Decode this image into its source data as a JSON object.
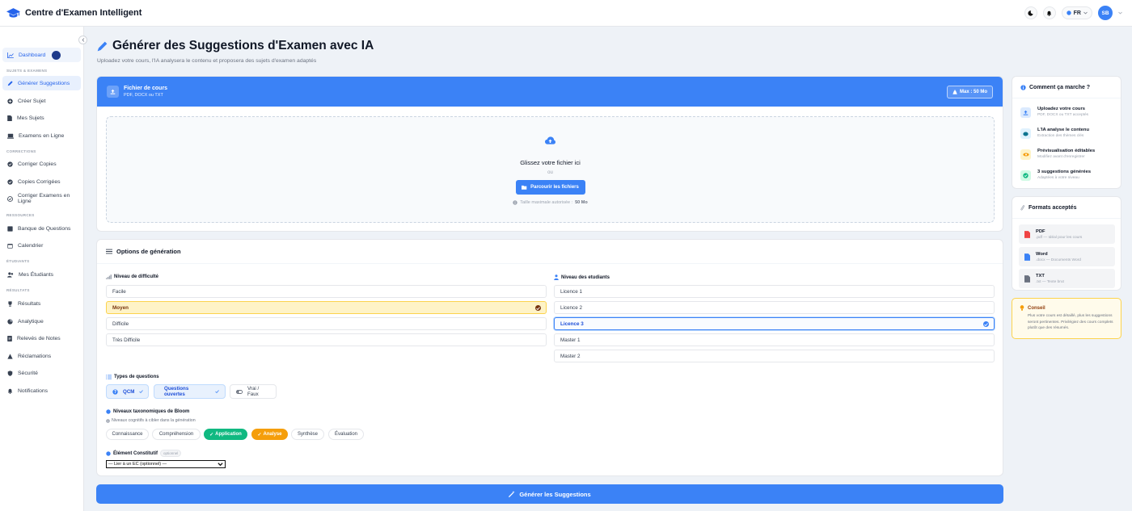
{
  "app": {
    "title": "Centre d'Examen Intelligent"
  },
  "topbar": {
    "lang": "FR",
    "user_initials": "SB"
  },
  "sidebar": {
    "dashboard": "Dashboard",
    "sections": {
      "sujets": "SUJETS & EXAMENS",
      "corrections": "CORRECTIONS",
      "ressources": "RESSOURCES",
      "etudiants": "ÉTUDIANTS",
      "resultats": "RÉSULTATS"
    },
    "items": [
      {
        "label": "Générer Suggestions"
      },
      {
        "label": "Créer Sujet"
      },
      {
        "label": "Mes Sujets"
      },
      {
        "label": "Examens en Ligne"
      },
      {
        "label": "Corriger Copies"
      },
      {
        "label": "Copies Corrigées"
      },
      {
        "label": "Corriger Examens en Ligne"
      },
      {
        "label": "Banque de Questions"
      },
      {
        "label": "Calendrier"
      },
      {
        "label": "Mes Étudiants"
      },
      {
        "label": "Résultats"
      },
      {
        "label": "Analytique"
      },
      {
        "label": "Relevés de Notes"
      },
      {
        "label": "Réclamations"
      },
      {
        "label": "Sécurité"
      },
      {
        "label": "Notifications"
      }
    ]
  },
  "page": {
    "title": "Générer des Suggestions d'Examen avec IA",
    "subtitle": "Uploadez votre cours, l'IA analysera le contenu et proposera des sujets d'examen adaptés"
  },
  "upload": {
    "title": "Fichier de cours",
    "subtitle": "PDF, DOCX ou TXT",
    "max_badge": "Max : 50 Mo",
    "drop_title": "Glissez votre fichier ici",
    "or": "ou",
    "browse": "Parcourir les fichiers",
    "size_note": "Taille maximale autorisée :",
    "size_value": "50 Mo"
  },
  "options": {
    "title": "Options de génération",
    "difficulty_label": "Niveau de difficulté",
    "difficulty": [
      "Facile",
      "Moyen",
      "Difficile",
      "Très Difficile"
    ],
    "students_label": "Niveau des etudiants",
    "students": [
      "Licence 1",
      "Licence 2",
      "Licence 3",
      "Master 1",
      "Master 2"
    ],
    "types_label": "Types de questions",
    "types": [
      "QCM",
      "Questions ouvertes",
      "Vrai / Faux"
    ],
    "bloom_label": "Niveaux taxonomiques de Bloom",
    "bloom_sub": "Niveaux cognitifs à cibler dans la génération",
    "bloom": [
      "Connaissance",
      "Compréhension",
      "Application",
      "Analyse",
      "Synthèse",
      "Évaluation"
    ],
    "ec_label": "Élément Constitutif",
    "ec_badge": "optionnel",
    "ec_select": "— Lier à un EC (optionnel) —"
  },
  "generate_button": "Générer les Suggestions",
  "how": {
    "title": "Comment ça marche ?",
    "steps": [
      {
        "title": "Uploadez votre cours",
        "desc": "PDF, DOCX ou TXT acceptés"
      },
      {
        "title": "L'IA analyse le contenu",
        "desc": "Extraction des thèmes clés"
      },
      {
        "title": "Prévisualisation éditables",
        "desc": "Modifiez avant d'enregistrer"
      },
      {
        "title": "3 suggestions générées",
        "desc": "Adaptées à votre niveau"
      }
    ]
  },
  "formats": {
    "title": "Formats acceptés",
    "items": [
      {
        "name": "PDF",
        "desc": ".pdf — Idéal pour les cours"
      },
      {
        "name": "Word",
        "desc": ".docx — Documents Word"
      },
      {
        "name": "TXT",
        "desc": ".txt — Texte brut"
      }
    ]
  },
  "tip": {
    "title": "Conseil",
    "text": "Plus votre cours est détaillé, plus les suggestions seront pertinentes. Privilégiez des cours complets plutôt que des résumés."
  },
  "colors": {
    "accent": "#3b82f6",
    "selected_yellow": "#fef3c7",
    "green": "#10b981",
    "orange": "#f59e0b"
  }
}
